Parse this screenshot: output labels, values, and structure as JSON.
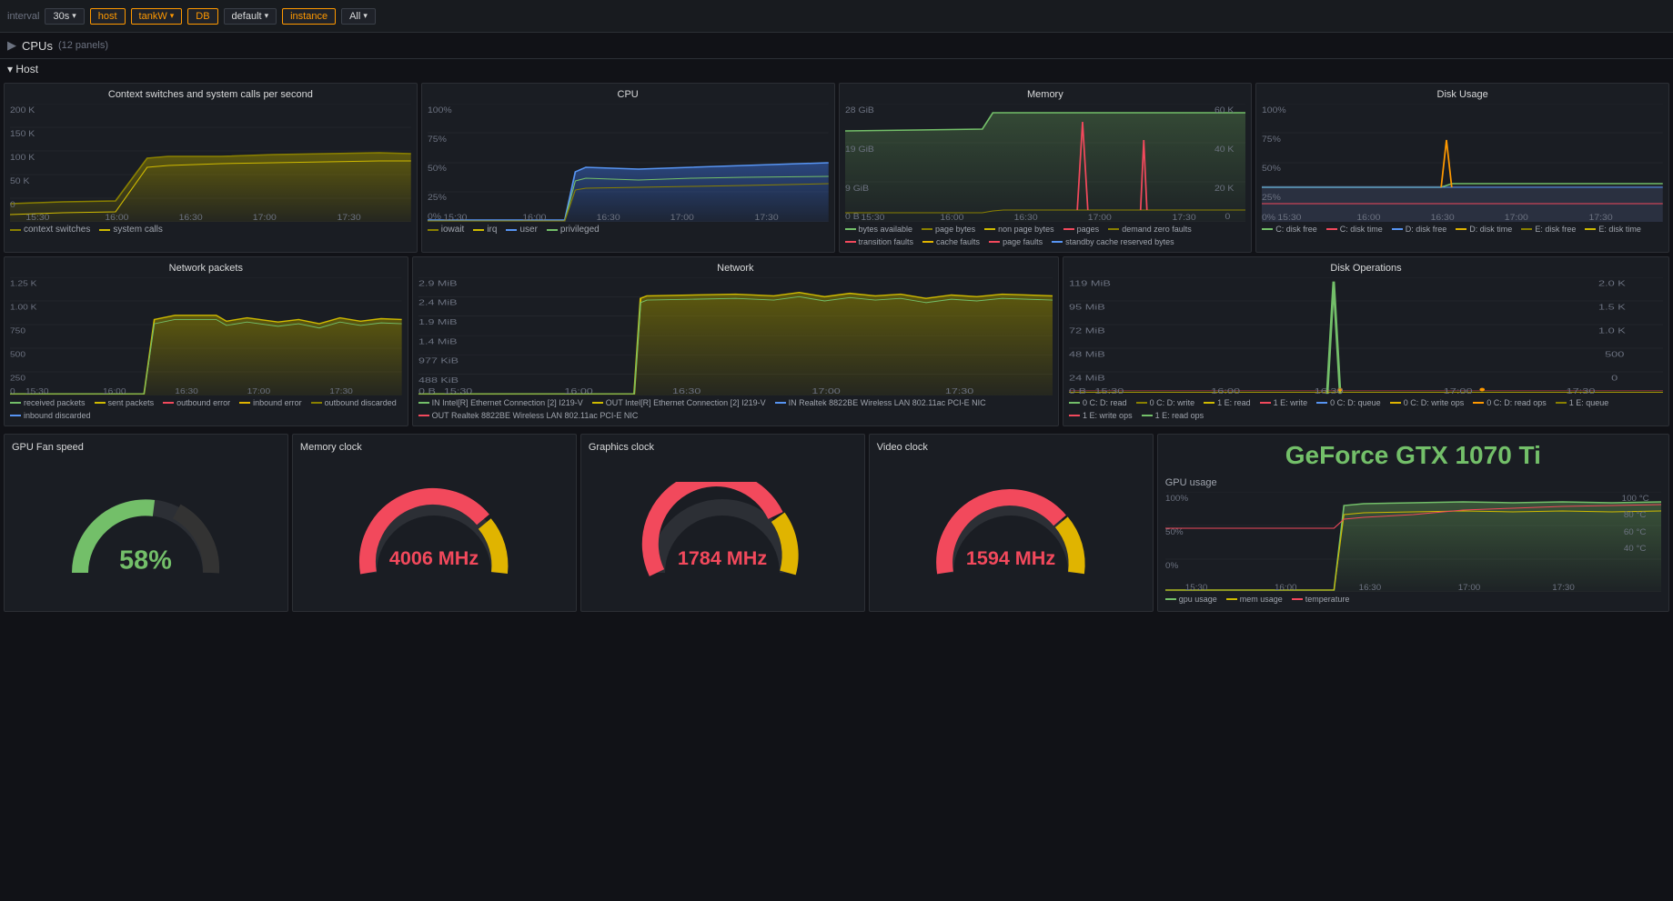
{
  "toolbar": {
    "interval_label": "interval",
    "interval_value": "30s",
    "host_label": "host",
    "host_value": "tankW",
    "db_label": "DB",
    "db_value": "default",
    "instance_label": "instance",
    "all_label": "All"
  },
  "cpus_section": {
    "label": "CPUs",
    "sub": "(12 panels)"
  },
  "host_section": {
    "label": "Host"
  },
  "panels": {
    "context_switches": {
      "title": "Context switches and system calls per second",
      "y_labels": [
        "200 K",
        "150 K",
        "100 K",
        "50 K",
        "0"
      ],
      "x_labels": [
        "15:30",
        "16:00",
        "16:30",
        "17:00",
        "17:30"
      ],
      "legend": [
        {
          "label": "context switches",
          "color": "#8a7f00"
        },
        {
          "label": "system calls",
          "color": "#cfba00"
        }
      ]
    },
    "cpu": {
      "title": "CPU",
      "y_labels": [
        "100%",
        "75%",
        "50%",
        "25%",
        "0%"
      ],
      "x_labels": [
        "15:30",
        "16:00",
        "16:30",
        "17:00",
        "17:30"
      ],
      "legend": [
        {
          "label": "iowait",
          "color": "#8a7f00"
        },
        {
          "label": "irq",
          "color": "#cfba00"
        },
        {
          "label": "user",
          "color": "#5794f2"
        },
        {
          "label": "privileged",
          "color": "#73bf69"
        }
      ]
    },
    "memory": {
      "title": "Memory",
      "y_labels_left": [
        "28 GiB",
        "19 GiB",
        "9 GiB",
        "0 B"
      ],
      "y_labels_right": [
        "60 K",
        "40 K",
        "20 K",
        "0"
      ],
      "x_labels": [
        "15:30",
        "16:00",
        "16:30",
        "17:00",
        "17:30"
      ],
      "legend": [
        {
          "label": "bytes available",
          "color": "#73bf69"
        },
        {
          "label": "page bytes",
          "color": "#8a7f00"
        },
        {
          "label": "non page bytes",
          "color": "#cfba00"
        },
        {
          "label": "pages",
          "color": "#f2495c"
        },
        {
          "label": "demand zero faults",
          "color": "#8a7f00"
        },
        {
          "label": "transition faults",
          "color": "#f2495c"
        },
        {
          "label": "cache faults",
          "color": "#e0b400"
        },
        {
          "label": "page faults",
          "color": "#f2495c"
        },
        {
          "label": "standby cache reserved bytes",
          "color": "#5794f2"
        }
      ]
    },
    "disk_usage": {
      "title": "Disk Usage",
      "y_labels": [
        "100%",
        "75%",
        "50%",
        "25%",
        "0%"
      ],
      "x_labels": [
        "15:30",
        "16:00",
        "16:30",
        "17:00",
        "17:30"
      ],
      "legend": [
        {
          "label": "C: disk free",
          "color": "#73bf69"
        },
        {
          "label": "C: disk time",
          "color": "#f2495c"
        },
        {
          "label": "D: disk free",
          "color": "#5794f2"
        },
        {
          "label": "D: disk time",
          "color": "#e0b400"
        },
        {
          "label": "E: disk free",
          "color": "#8a7f00"
        },
        {
          "label": "E: disk time",
          "color": "#cfba00"
        }
      ]
    },
    "network_packets": {
      "title": "Network packets",
      "y_labels": [
        "1.25 K",
        "1.00 K",
        "750",
        "500",
        "250",
        "0"
      ],
      "x_labels": [
        "15:30",
        "16:00",
        "16:30",
        "17:00",
        "17:30"
      ],
      "legend": [
        {
          "label": "received packets",
          "color": "#73bf69"
        },
        {
          "label": "sent packets",
          "color": "#cfba00"
        },
        {
          "label": "outbound error",
          "color": "#f2495c"
        },
        {
          "label": "inbound error",
          "color": "#e0b400"
        },
        {
          "label": "outbound discarded",
          "color": "#8a7f00"
        },
        {
          "label": "inbound discarded",
          "color": "#5794f2"
        }
      ]
    },
    "network": {
      "title": "Network",
      "y_labels": [
        "2.9 MiB",
        "2.4 MiB",
        "1.9 MiB",
        "1.4 MiB",
        "977 KiB",
        "488 KiB",
        "0 B"
      ],
      "x_labels": [
        "15:30",
        "16:00",
        "16:30",
        "17:00",
        "17:30"
      ],
      "legend": [
        {
          "label": "IN Intel[R] Ethernet Connection [2] I219-V",
          "color": "#73bf69"
        },
        {
          "label": "OUT Intel[R] Ethernet Connection [2] I219-V",
          "color": "#cfba00"
        },
        {
          "label": "IN Realtek 8822BE Wireless LAN 802.11ac PCI-E NIC",
          "color": "#5794f2"
        },
        {
          "label": "OUT Realtek 8822BE Wireless LAN 802.11ac PCI-E NIC",
          "color": "#f2495c"
        }
      ]
    },
    "disk_operations": {
      "title": "Disk Operations",
      "y_labels_left": [
        "119 MiB",
        "95 MiB",
        "72 MiB",
        "48 MiB",
        "24 MiB",
        "0 B"
      ],
      "y_labels_right": [
        "2.0 K",
        "1.5 K",
        "1.0 K",
        "500",
        "0"
      ],
      "x_labels": [
        "15:30",
        "16:00",
        "16:30",
        "17:00",
        "17:30"
      ],
      "legend": [
        {
          "label": "0 C: D: read",
          "color": "#73bf69"
        },
        {
          "label": "0 C: D: write",
          "color": "#8a7f00"
        },
        {
          "label": "1 E: read",
          "color": "#cfba00"
        },
        {
          "label": "1 E: write",
          "color": "#f2495c"
        },
        {
          "label": "0 C: D: queue",
          "color": "#5794f2"
        },
        {
          "label": "0 C: D: write ops",
          "color": "#e0b400"
        },
        {
          "label": "0 C: D: read ops",
          "color": "#ff9900"
        },
        {
          "label": "1 E: queue",
          "color": "#8a7f00"
        },
        {
          "label": "1 E: write ops",
          "color": "#f2495c"
        },
        {
          "label": "1 E: read ops",
          "color": "#73bf69"
        }
      ]
    }
  },
  "gauges": {
    "fan_speed": {
      "title": "GPU Fan speed",
      "value": "58%",
      "color": "green",
      "percent": 58
    },
    "memory_clock": {
      "title": "Memory clock",
      "value": "4006 MHz",
      "color": "red",
      "percent": 85
    },
    "graphics_clock": {
      "title": "Graphics clock",
      "value": "1784 MHz",
      "color": "red",
      "percent": 90
    },
    "video_clock": {
      "title": "Video clock",
      "value": "1594 MHz",
      "color": "red",
      "percent": 88
    }
  },
  "gpu_panel": {
    "title": "GeForce GTX 1070 Ti",
    "usage_title": "GPU usage",
    "y_labels": [
      "100%",
      "50%",
      "0%"
    ],
    "y_labels_right": [
      "100 °C",
      "80 °C",
      "60 °C",
      "40 °C"
    ],
    "x_labels": [
      "15:30",
      "16:00",
      "16:30",
      "17:00",
      "17:30"
    ],
    "legend": [
      {
        "label": "gpu usage",
        "color": "#73bf69"
      },
      {
        "label": "mem usage",
        "color": "#cfba00"
      },
      {
        "label": "temperature",
        "color": "#f2495c"
      }
    ]
  }
}
